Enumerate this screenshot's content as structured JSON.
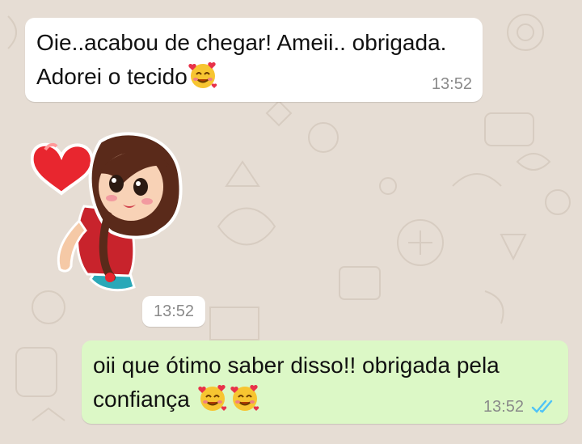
{
  "chat": {
    "messages": [
      {
        "direction": "incoming",
        "line1": "Oie..acabou de chegar! Ameii.. obrigada.",
        "line2": "Adorei o tecido",
        "emoji": "smiling-face-with-hearts",
        "time": "13:52"
      },
      {
        "direction": "incoming",
        "type": "sticker",
        "sticker": "girl-with-heart-sticker",
        "time": "13:52"
      },
      {
        "direction": "outgoing",
        "line1": "oii que ótimo saber disso!! obrigada pela",
        "line2": "confiança",
        "emoji": "smiling-face-with-hearts",
        "emoji_count": 2,
        "time": "13:52",
        "status": "read-double-check"
      }
    ]
  },
  "colors": {
    "wallpaper": "#e6ddd4",
    "incoming_bubble": "#ffffff",
    "outgoing_bubble": "#dcf8c6",
    "read_ticks": "#4fc3f7"
  }
}
